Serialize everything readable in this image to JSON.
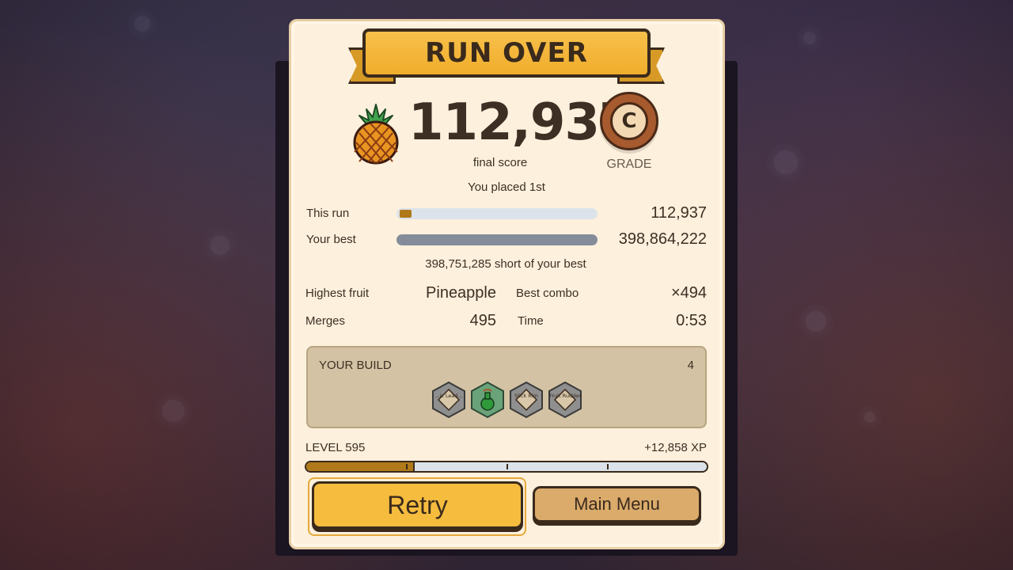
{
  "screen": {
    "title": "RUN OVER",
    "final_score": "112,937",
    "final_score_label": "final score",
    "grade": "C",
    "grade_label": "GRADE",
    "placement": "You placed 1st",
    "fruit_icon": "pineapple-icon"
  },
  "comparison": {
    "this_run_label": "This run",
    "this_run_value": "112,937",
    "this_run_fill_fraction": 0.06,
    "best_label": "Your best",
    "best_value": "398,864,222",
    "best_fill_fraction": 1.0,
    "short_text": "398,751,285 short of your best"
  },
  "stats": {
    "highest_fruit_label": "Highest fruit",
    "highest_fruit_value": "Pineapple",
    "best_combo_label": "Best combo",
    "best_combo_value": "×494",
    "merges_label": "Merges",
    "merges_value": "495",
    "time_label": "Time",
    "time_value": "0:53"
  },
  "build": {
    "title": "YOUR BUILD",
    "count": "4",
    "items": [
      {
        "name": "item-1",
        "label": "...ic Lead..."
      },
      {
        "name": "item-2-potion",
        "label": ""
      },
      {
        "name": "item-3",
        "label": "Slick Rim"
      },
      {
        "name": "item-4",
        "label": "Fruit Rudder"
      }
    ]
  },
  "level": {
    "label": "LEVEL 595",
    "xp_gain": "+12,858 XP",
    "progress_fraction": 0.27
  },
  "buttons": {
    "retry": "Retry",
    "main_menu": "Main Menu"
  },
  "colors": {
    "panel": "#fdf0dc",
    "banner": "#f0ad2c",
    "retry_button": "#f5bc3e",
    "menu_button": "#dbab6c",
    "grade_medal": "#a65a2e",
    "progress_fill": "#b07a1a"
  }
}
